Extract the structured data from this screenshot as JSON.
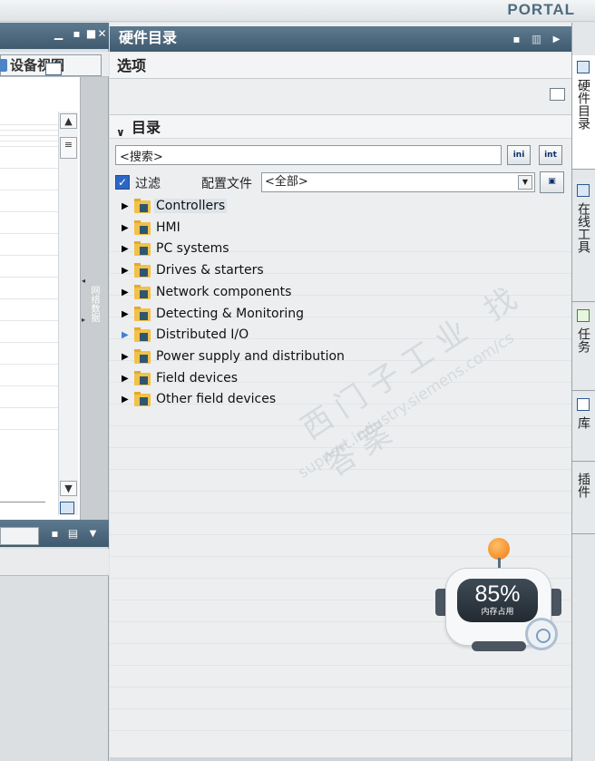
{
  "app": {
    "brand": "PORTAL"
  },
  "left_pane": {
    "device_view_tab": "设备视图",
    "collapsed_sidebar_label": "网络数据"
  },
  "main_panel": {
    "title": "硬件目录",
    "options_header": "选项",
    "catalog_header": "目录",
    "search": {
      "value": "<搜索>",
      "placeholder": "<搜索>"
    },
    "search_down_label": "ini",
    "search_up_label": "int",
    "filter": {
      "label": "过滤",
      "checked": true
    },
    "profile": {
      "label": "配置文件",
      "value": "<全部>"
    },
    "tree": [
      {
        "label": "Controllers",
        "selected": true,
        "arrow": "▶",
        "arrow_color": "#000000"
      },
      {
        "label": "HMI",
        "selected": false,
        "arrow": "▶",
        "arrow_color": "#000000"
      },
      {
        "label": "PC systems",
        "selected": false,
        "arrow": "▶",
        "arrow_color": "#000000"
      },
      {
        "label": "Drives & starters",
        "selected": false,
        "arrow": "▶",
        "arrow_color": "#000000"
      },
      {
        "label": "Network components",
        "selected": false,
        "arrow": "▶",
        "arrow_color": "#000000"
      },
      {
        "label": "Detecting & Monitoring",
        "selected": false,
        "arrow": "▶",
        "arrow_color": "#000000"
      },
      {
        "label": "Distributed I/O",
        "selected": false,
        "arrow": "▶",
        "arrow_color": "#3d7fd1"
      },
      {
        "label": "Power supply and distribution",
        "selected": false,
        "arrow": "▶",
        "arrow_color": "#000000"
      },
      {
        "label": "Field devices",
        "selected": false,
        "arrow": "▶",
        "arrow_color": "#000000"
      },
      {
        "label": "Other field devices",
        "selected": false,
        "arrow": "▶",
        "arrow_color": "#000000"
      }
    ]
  },
  "watermark": {
    "line1": "西门子工业 找答案",
    "line2": "support.industry.siemens.com/cs"
  },
  "memory_widget": {
    "percent": "85%",
    "label": "内存占用"
  },
  "right_tabs": [
    {
      "label": "硬件目录",
      "active": true
    },
    {
      "label": "在线工具",
      "active": false
    },
    {
      "label": "任务",
      "active": false
    },
    {
      "label": "库",
      "active": false
    },
    {
      "label": "插件",
      "active": false
    }
  ]
}
